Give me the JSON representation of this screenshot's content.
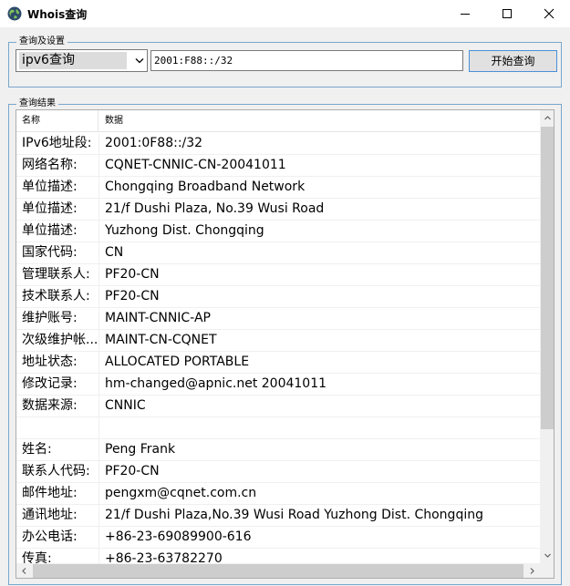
{
  "window": {
    "title": "Whois查询"
  },
  "settings": {
    "group_label": "查询及设置",
    "query_type": "ipv6查询",
    "query_value": "2001:F88::/32",
    "start_button": "开始查询"
  },
  "results": {
    "group_label": "查询结果",
    "columns": {
      "name": "名称",
      "data": "数据"
    },
    "rows": [
      {
        "name": "IPv6地址段:",
        "value": "2001:0F88::/32"
      },
      {
        "name": "网络名称:",
        "value": "CQNET-CNNIC-CN-20041011"
      },
      {
        "name": "单位描述:",
        "value": "Chongqing Broadband Network"
      },
      {
        "name": "单位描述:",
        "value": "21/f Dushi Plaza, No.39 Wusi Road"
      },
      {
        "name": "单位描述:",
        "value": "Yuzhong Dist.  Chongqing"
      },
      {
        "name": "国家代码:",
        "value": "CN"
      },
      {
        "name": "管理联系人:",
        "value": "PF20-CN"
      },
      {
        "name": "技术联系人:",
        "value": "PF20-CN"
      },
      {
        "name": "维护账号:",
        "value": "MAINT-CNNIC-AP"
      },
      {
        "name": "次级维护帐...",
        "value": "MAINT-CN-CQNET"
      },
      {
        "name": "地址状态:",
        "value": "ALLOCATED PORTABLE"
      },
      {
        "name": "修改记录:",
        "value": "hm-changed@apnic.net 20041011"
      },
      {
        "name": "数据来源:",
        "value": "CNNIC"
      },
      {
        "name": "",
        "value": ""
      },
      {
        "name": "姓名:",
        "value": "Peng Frank"
      },
      {
        "name": "联系人代码:",
        "value": "PF20-CN"
      },
      {
        "name": "邮件地址:",
        "value": "pengxm@cqnet.com.cn"
      },
      {
        "name": "通讯地址:",
        "value": "21/f Dushi Plaza,No.39 Wusi Road Yuzhong Dist. Chongqing"
      },
      {
        "name": "办公电话:",
        "value": "+86-23-69089900-616"
      },
      {
        "name": "传真:",
        "value": "+86-23-63782270"
      }
    ]
  },
  "icons": {
    "app": "globe-icon",
    "minimize": "minimize-icon",
    "maximize": "maximize-icon",
    "close": "close-icon",
    "dropdown": "chevron-down-icon"
  },
  "colors": {
    "group_border": "#7aa6cc",
    "button_focus_border": "#4a90d9",
    "window_bg": "#f0f0f0"
  }
}
